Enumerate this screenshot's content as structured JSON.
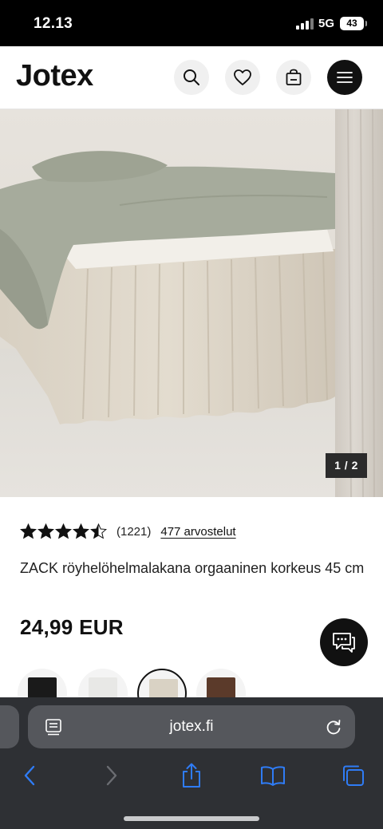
{
  "status_bar": {
    "time": "12.13",
    "network": "5G",
    "battery": "43"
  },
  "header": {
    "logo": "Jotex",
    "icons": {
      "search": "search-icon",
      "favorites": "heart-icon",
      "cart": "shopping-bag-icon",
      "menu": "hamburger-menu-icon"
    }
  },
  "gallery": {
    "pager": "1 / 2"
  },
  "product": {
    "rating": {
      "stars": 4.5,
      "max": 5,
      "count": "(1221)",
      "reviews_link": "477 arvostelut"
    },
    "title": "ZACK röyhelöhelmalakana orgaaninen korkeus 45 cm",
    "price": "24,99 EUR",
    "swatches": [
      {
        "color": "#1a1a1a",
        "selected": false
      },
      {
        "color": "#e8e8e6",
        "selected": false
      },
      {
        "color": "#d9d2c4",
        "selected": true
      },
      {
        "color": "#5b3a2a",
        "selected": false
      }
    ]
  },
  "browser": {
    "url": "jotex.fi",
    "icons": {
      "reader": "page-menu-icon",
      "reload": "reload-icon",
      "back": "back-icon",
      "forward": "forward-icon",
      "share": "share-icon",
      "bookmarks": "bookmarks-icon",
      "tabs": "tabs-icon"
    }
  },
  "colors": {
    "brand_black": "#111111",
    "safari_bar": "#2e3034",
    "safari_field": "#55575c",
    "ios_blue": "#2f7cf6"
  }
}
